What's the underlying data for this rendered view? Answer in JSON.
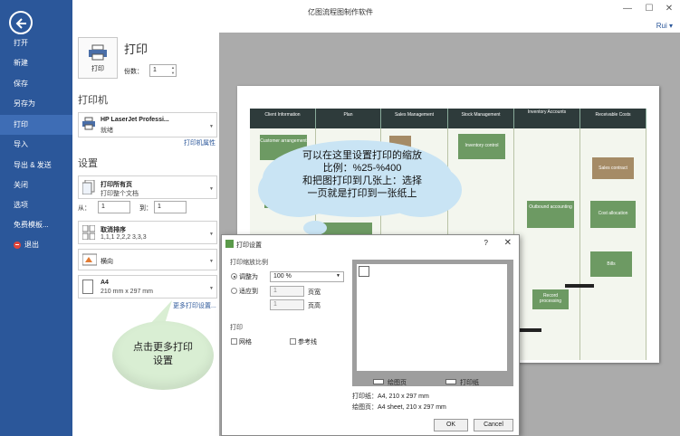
{
  "window": {
    "title": "亿图流程图制作软件",
    "user": "Rui",
    "min_glyph": "—",
    "max_glyph": "☐",
    "close_glyph": "✕"
  },
  "sidebar": {
    "items": [
      "打开",
      "新建",
      "保存",
      "另存为",
      "打印",
      "导入",
      "导出 & 发送",
      "关闭",
      "选项",
      "免费模板...",
      "退出"
    ],
    "active_index": 4
  },
  "print": {
    "title": "打印",
    "button_label": "打印",
    "copies_label": "份数：",
    "copies_value": "1"
  },
  "printer": {
    "section_title": "打印机",
    "name": "HP LaserJet Professi...",
    "status": "就绪",
    "properties_link": "打印机属性"
  },
  "settings": {
    "section_title": "设置",
    "pages_title": "打印所有页",
    "pages_sub": "打印整个文档",
    "from_label": "从：",
    "from_value": "1",
    "to_label": "到：",
    "to_value": "1",
    "collate_title": "取消排序",
    "collate_sub": "1,1,1   2,2,2   3,3,3",
    "orientation": "横向",
    "paper_title": "A4",
    "paper_sub": "210 mm x 297 mm",
    "more_link": "更多打印设置..."
  },
  "diagram": {
    "lanes": [
      "Client Information",
      "Plan",
      "Sales Management",
      "Stock Management",
      "Inventory Accounts",
      "Receivable Costs"
    ],
    "nodes": [
      "Customer arrangement",
      "Inventory control",
      "Sales contract",
      "Outbound accounting",
      "Cost allocation",
      "Bills",
      "Record processing"
    ]
  },
  "callouts": {
    "cloud_lines": [
      "可以在这里设置打印的缩放",
      "比例：%25-%400",
      "和把图打印到几张上：选择",
      "一页就是打印到一张纸上"
    ],
    "bubble_lines": [
      "点击更多打印",
      "设置"
    ]
  },
  "dialog": {
    "title": "打印设置",
    "help": "?",
    "close": "✕",
    "scale_group": "打印缩放比例",
    "adjust_label": "调整为",
    "adjust_value": "100 %",
    "fit_label": "适应到",
    "fit_w": "1",
    "fit_h": "1",
    "page_wide": "页宽",
    "page_high": "页高",
    "print_group": "打印",
    "grid_label": "网格",
    "guides_label": "参考线",
    "legend_drawing": "绘图页",
    "legend_print": "打印纸",
    "print_paper_info": "打印纸：A4, 210 x 297 mm",
    "drawing_page_info": "绘图页：A4 sheet, 210 x 297 mm",
    "ok": "OK",
    "cancel": "Cancel"
  }
}
